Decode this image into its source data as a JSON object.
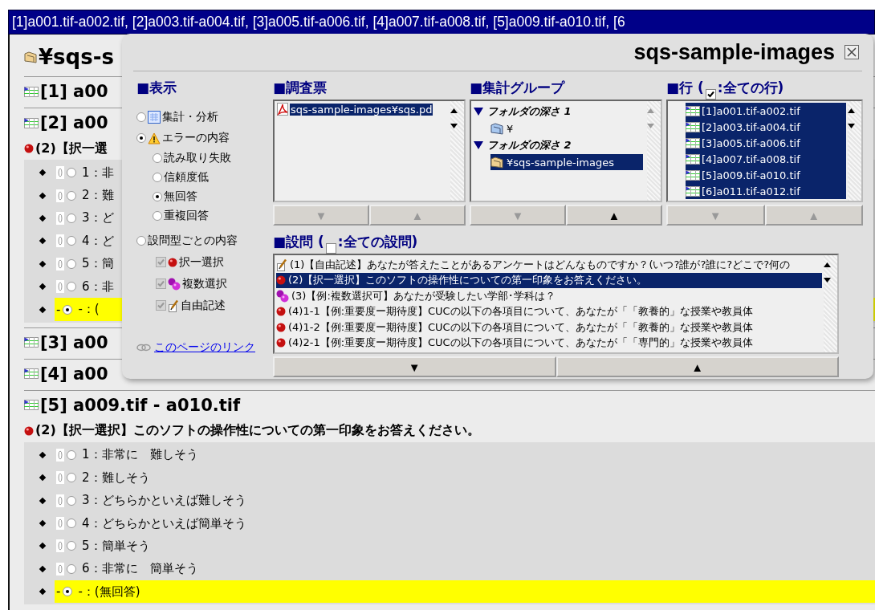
{
  "window": {
    "title": "[1]a001.tif-a002.tif, [2]a003.tif-a004.tif, [3]a005.tif-a006.tif, [4]a007.tif-a008.tif, [5]a009.tif-a010.tif, [6"
  },
  "page": {
    "heading": "¥sqs-s",
    "sections": [
      {
        "title": "[1] a00"
      },
      {
        "title": "[2] a00",
        "question": {
          "kind": "single",
          "title": "(2)【択一選",
          "options": [
            {
              "label": "1：非",
              "selected": false
            },
            {
              "label": "2：難",
              "selected": false
            },
            {
              "label": "3：ど",
              "selected": false
            },
            {
              "label": "4：ど",
              "selected": false
            },
            {
              "label": "5：簡",
              "selected": false
            },
            {
              "label": "6：非",
              "selected": false
            },
            {
              "prefix": "-",
              "label": "-：(",
              "selected": true
            }
          ]
        }
      },
      {
        "title": "[3] a00"
      },
      {
        "title": "[4] a00"
      },
      {
        "title": "[5] a009.tif - a010.tif",
        "question": {
          "kind": "single",
          "title": "(2)【択一選択】このソフトの操作性についての第一印象をお答えください。",
          "options": [
            {
              "label": "1：非常に　難しそう",
              "selected": false
            },
            {
              "label": "2：難しそう",
              "selected": false
            },
            {
              "label": "3：どちらかといえば難しそう",
              "selected": false
            },
            {
              "label": "4：どちらかといえば簡単そう",
              "selected": false
            },
            {
              "label": "5：簡単そう",
              "selected": false
            },
            {
              "label": "6：非常に　簡単そう",
              "selected": false
            },
            {
              "prefix": "-",
              "label": "-：(無回答)",
              "selected": true
            }
          ]
        }
      }
    ]
  },
  "panel": {
    "title": "sqs-sample-images",
    "display": {
      "heading": "■表示",
      "options": [
        {
          "kind": "summary",
          "label": "集計・分析",
          "selected": false
        },
        {
          "kind": "error",
          "label": "エラーの内容",
          "selected": true,
          "children": [
            {
              "label": "読み取り失敗",
              "selected": false
            },
            {
              "label": "信頼度低",
              "selected": false
            },
            {
              "label": "無回答",
              "selected": true
            },
            {
              "label": "重複回答",
              "selected": false
            }
          ]
        },
        {
          "kind": "plain",
          "label": "設問型ごとの内容",
          "selected": false,
          "checkboxes": [
            {
              "kind": "single",
              "label": "択一選択",
              "checked": true,
              "disabled": true
            },
            {
              "kind": "multiple",
              "label": "複数選択",
              "checked": true,
              "disabled": true
            },
            {
              "kind": "free",
              "label": "自由記述",
              "checked": true,
              "disabled": true
            }
          ]
        }
      ],
      "link": "このページのリンク"
    },
    "survey": {
      "heading": "■調査票",
      "items": [
        {
          "label": "sqs-sample-images¥sqs.pd",
          "selected": true
        }
      ],
      "buttons": [
        {
          "label": "▼",
          "disabled": true
        },
        {
          "label": "▲",
          "disabled": true
        }
      ]
    },
    "groups": {
      "heading": "■集計グループ",
      "tree": [
        {
          "label": "フォルダの深さ 1",
          "expanded": true,
          "children": [
            {
              "label": "¥",
              "selected": false
            }
          ]
        },
        {
          "label": "フォルダの深さ 2",
          "expanded": true,
          "children": [
            {
              "label": "¥sqs-sample-images",
              "selected": true
            }
          ]
        }
      ],
      "buttons": [
        {
          "label": "▼",
          "disabled": true
        },
        {
          "label": "▲",
          "disabled": false
        }
      ]
    },
    "rows": {
      "heading": "■行 (",
      "all_label": ":全ての行)",
      "all_checked": true,
      "items": [
        {
          "label": "[1]a001.tif-a002.tif",
          "selected": true
        },
        {
          "label": "[2]a003.tif-a004.tif",
          "selected": true
        },
        {
          "label": "[3]a005.tif-a006.tif",
          "selected": true
        },
        {
          "label": "[4]a007.tif-a008.tif",
          "selected": true
        },
        {
          "label": "[5]a009.tif-a010.tif",
          "selected": true
        },
        {
          "label": "[6]a011.tif-a012.tif",
          "selected": true
        }
      ],
      "buttons": [
        {
          "label": "▼",
          "disabled": true
        },
        {
          "label": "▲",
          "disabled": true
        }
      ]
    },
    "questions": {
      "heading": "■設問 (",
      "all_label": ":全ての設問)",
      "all_checked": false,
      "items": [
        {
          "kind": "free",
          "label": "(1)【自由記述】あなたが答えたことがあるアンケートはどんなものですか？(いつ?誰が?誰に?どこで?何の",
          "selected": false
        },
        {
          "kind": "single",
          "label": "(2)【択一選択】このソフトの操作性についての第一印象をお答えください。",
          "selected": true
        },
        {
          "kind": "multiple",
          "label": "(3)【例:複数選択可】あなたが受験したい学部･学科は？",
          "selected": false
        },
        {
          "kind": "single",
          "label": "(4)1-1【例:重要度ー期待度】CUCの以下の各項目について、あなたが「「教養的」な授業や教員体",
          "selected": false
        },
        {
          "kind": "single",
          "label": "(4)1-2【例:重要度ー期待度】CUCの以下の各項目について、あなたが「「教養的」な授業や教員体",
          "selected": false
        },
        {
          "kind": "single",
          "label": "(4)2-1【例:重要度ー期待度】CUCの以下の各項目について、あなたが「「専門的」な授業や教員体",
          "selected": false
        }
      ],
      "buttons": [
        {
          "label": "▼",
          "disabled": false
        },
        {
          "label": "▲",
          "disabled": false
        }
      ]
    }
  }
}
